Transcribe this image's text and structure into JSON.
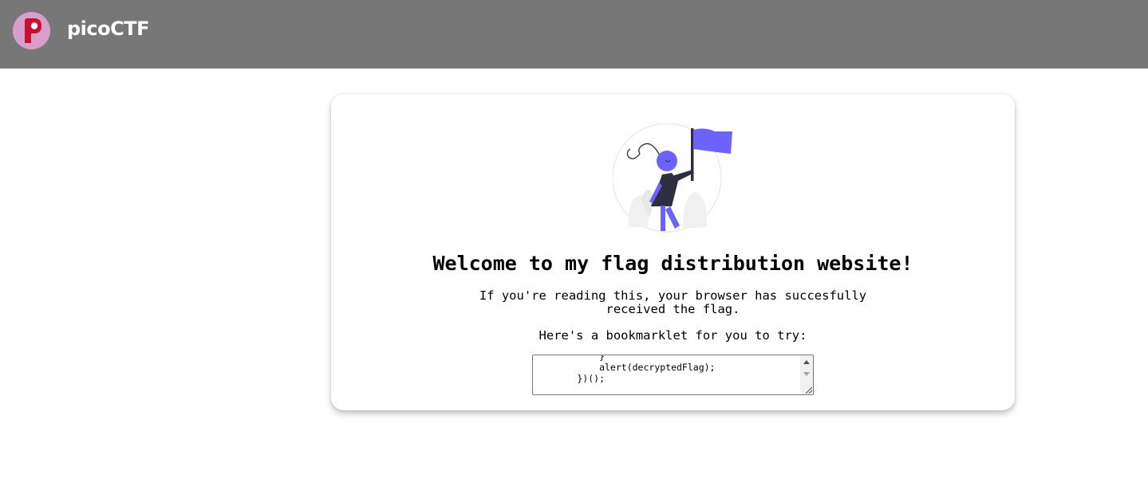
{
  "header": {
    "brand": "picoCTF",
    "logo_letter": "P",
    "logo_colors": {
      "circle": "#d79fcb",
      "letter": "#c8102e"
    }
  },
  "main": {
    "title": "Welcome to my flag distribution website!",
    "message_line1": "If you're reading this, your browser has succesfully",
    "message_line2": "received the flag.",
    "bookmarklet_label": "Here's a bookmarklet for you to try:",
    "bookmarklet_code": "            }\n            alert(decryptedFlag);\n        })();"
  },
  "colors": {
    "header_bg": "#777777",
    "accent": "#6c63ff",
    "dark": "#2f2e41"
  }
}
